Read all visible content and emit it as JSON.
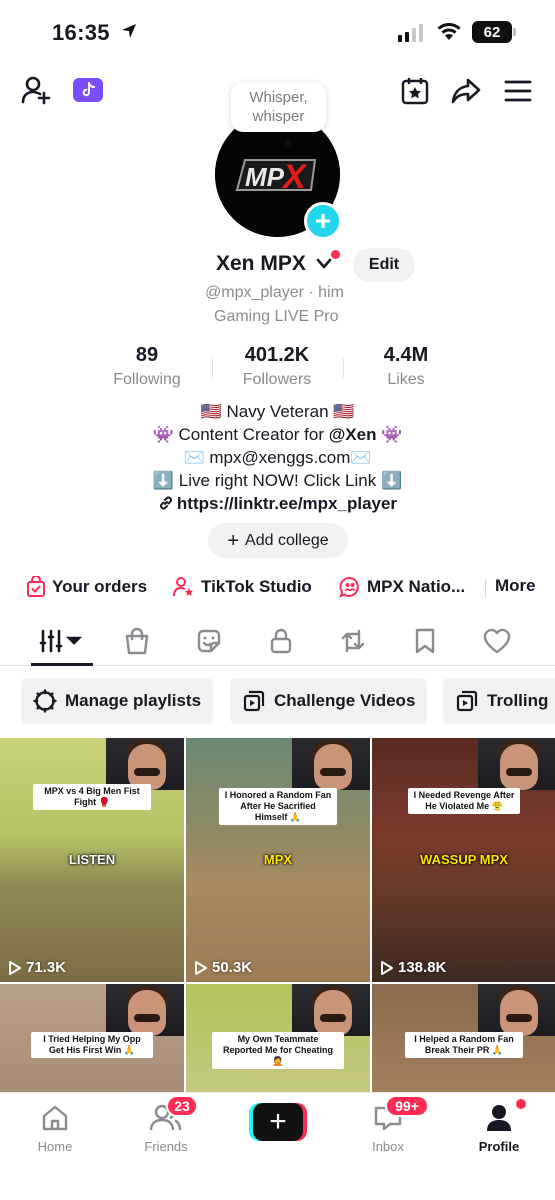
{
  "status_bar": {
    "time": "16:35",
    "battery": "62"
  },
  "tooltip": {
    "text_line1": "Whisper,",
    "text_line2": "whisper"
  },
  "avatar": {
    "logo_text_mp": "MP",
    "logo_text_x": "X"
  },
  "profile": {
    "name": "Xen MPX",
    "edit_label": "Edit",
    "handle": "@mpx_player · him",
    "category": "Gaming LIVE Pro"
  },
  "stats": [
    {
      "value": "89",
      "label": "Following"
    },
    {
      "value": "401.2K",
      "label": "Followers"
    },
    {
      "value": "4.4M",
      "label": "Likes"
    }
  ],
  "bio": {
    "line1": "🇺🇸 Navy Veteran 🇺🇸",
    "line2_pre": "👾 Content Creator for ",
    "line2_bold": "@Xen",
    "line2_post": " 👾",
    "line3": "✉️ mpx@xenggs.com✉️",
    "line4": "⬇️ Live right NOW! Click Link ⬇️",
    "link": "https://linktr.ee/mpx_player"
  },
  "add_college_label": "Add college",
  "quick_links": {
    "orders": "Your orders",
    "studio": "TikTok Studio",
    "nation": "MPX Natio...",
    "more": "More"
  },
  "playlists": {
    "manage": "Manage playlists",
    "challenge": "Challenge Videos",
    "trolling": "Trolling"
  },
  "videos": [
    {
      "caption": "MPX vs 4 Big Men Fist Fight 🥊",
      "overlay": "LISTEN",
      "views": "71.3K"
    },
    {
      "caption": "I Honored a Random Fan After He Sacrified Himself 🙏",
      "overlay": "MPX",
      "views": "50.3K"
    },
    {
      "caption": "I Needed Revenge After He Violated Me 😤",
      "overlay": "WASSUP MPX",
      "views": "138.8K"
    },
    {
      "caption": "I Tried Helping My Opp Get His First Win 🙏",
      "overlay": "",
      "views": ""
    },
    {
      "caption": "My Own Teammate Reported Me for Cheating 🤦",
      "overlay": "",
      "views": ""
    },
    {
      "caption": "I Helped a Random Fan Break Their PR 🙏",
      "overlay": "",
      "views": ""
    }
  ],
  "bottom_nav": {
    "home": "Home",
    "friends": "Friends",
    "friends_badge": "23",
    "inbox": "Inbox",
    "inbox_badge": "99+",
    "profile": "Profile"
  },
  "colors": {
    "accent_red": "#fe2c55",
    "accent_cyan": "#20d5ec",
    "text_primary": "#161823",
    "text_secondary": "#8a8b91",
    "live_badge_purple": "#7b4dff"
  }
}
